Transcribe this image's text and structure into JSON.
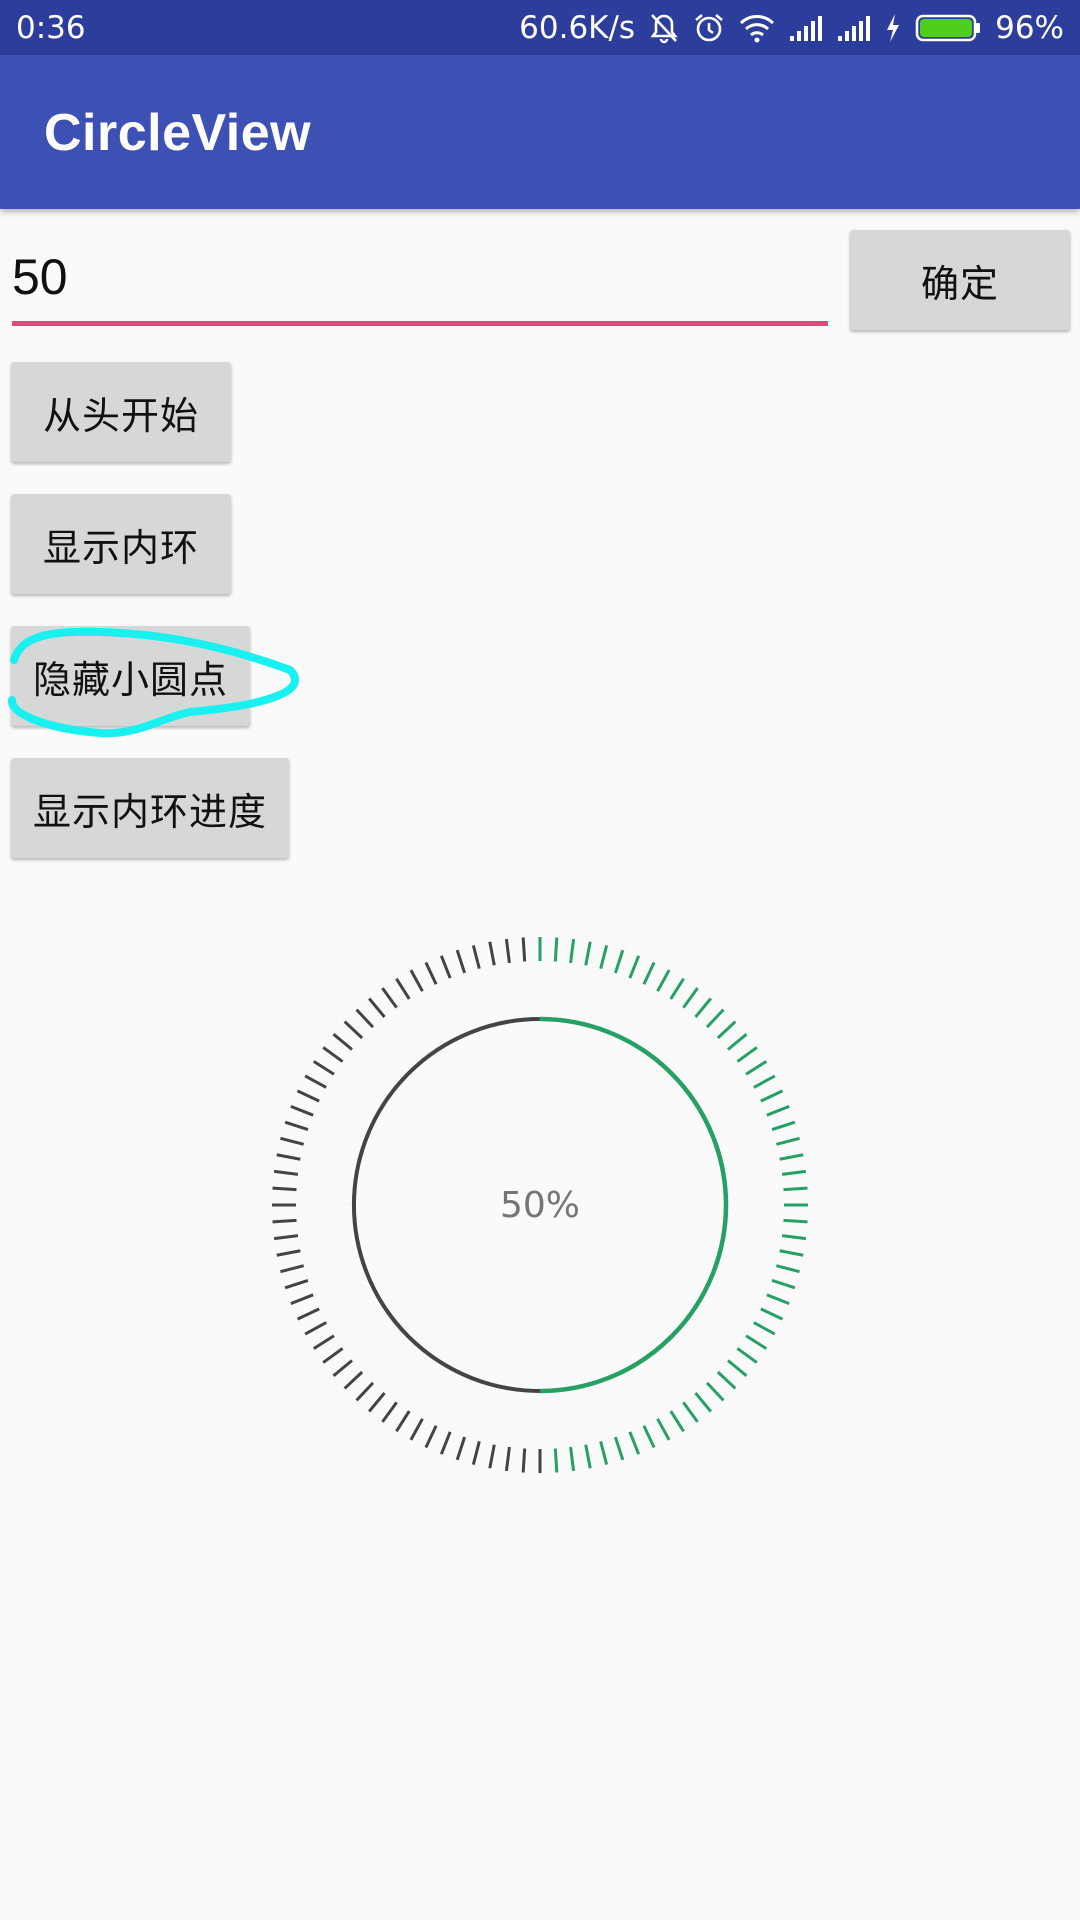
{
  "status_bar": {
    "time": "0:36",
    "network_speed": "60.6K/s",
    "battery": "96%",
    "icons": [
      "mute-icon",
      "alarm-icon",
      "wifi-icon",
      "signal-icon",
      "signal-icon",
      "charging-icon",
      "battery-icon"
    ]
  },
  "app_bar": {
    "title": "CircleView"
  },
  "input": {
    "value": "50"
  },
  "buttons": {
    "confirm": "确定",
    "restart": "从头开始",
    "show_inner_ring": "显示内环",
    "hide_small_dot": "隐藏小圆点",
    "show_inner_ring_progress": "显示内环进度"
  },
  "circle_view": {
    "progress": 0.5,
    "label": "50%",
    "tick_count": 100,
    "colors": {
      "progress": "#26a065",
      "remaining": "#444444",
      "label": "#757575",
      "annotation": "#19f0f0"
    }
  }
}
